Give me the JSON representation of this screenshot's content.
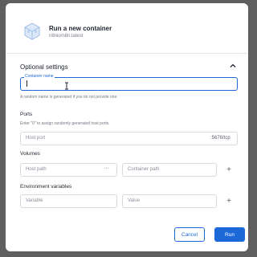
{
  "dialog": {
    "title": "Run a new container",
    "subtitle": "n8nio/n8n:latest"
  },
  "optional_settings": {
    "title": "Optional settings",
    "container_name": {
      "label": "Container name",
      "value": "",
      "helper": "A random name is generated if you do not provide one."
    },
    "ports": {
      "title": "Ports",
      "helper": "Enter \"0\" to assign randomly generated host ports.",
      "host_port_placeholder": "Host port",
      "container_port": ":5678/tcp"
    },
    "volumes": {
      "title": "Volumes",
      "host_path_placeholder": "Host path",
      "browse": "···",
      "container_path_placeholder": "Container path",
      "add": "+"
    },
    "env": {
      "title": "Environment variables",
      "variable_placeholder": "Variable",
      "value_placeholder": "Value",
      "add": "+"
    }
  },
  "buttons": {
    "cancel": "Cancel",
    "run": "Run"
  },
  "colors": {
    "accent": "#1d68d9",
    "backdrop": "#5f5f5f"
  },
  "icons": {
    "header": "container-box-icon",
    "collapse": "chevron-up-icon",
    "cursor": "text-cursor-icon"
  }
}
